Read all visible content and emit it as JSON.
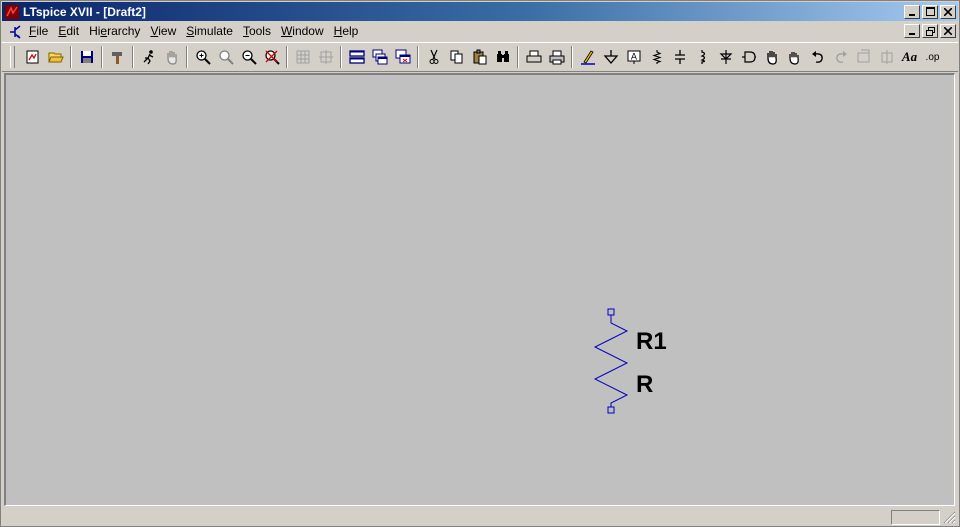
{
  "window": {
    "title": "LTspice XVII - [Draft2]"
  },
  "menu": {
    "items": [
      {
        "id": "file",
        "pre": "",
        "acc": "F",
        "post": "ile"
      },
      {
        "id": "edit",
        "pre": "",
        "acc": "E",
        "post": "dit"
      },
      {
        "id": "hierarchy",
        "pre": "Hi",
        "acc": "e",
        "post": "rarchy"
      },
      {
        "id": "view",
        "pre": "",
        "acc": "V",
        "post": "iew"
      },
      {
        "id": "simulate",
        "pre": "",
        "acc": "S",
        "post": "imulate"
      },
      {
        "id": "tools",
        "pre": "",
        "acc": "T",
        "post": "ools"
      },
      {
        "id": "window",
        "pre": "",
        "acc": "W",
        "post": "indow"
      },
      {
        "id": "help",
        "pre": "",
        "acc": "H",
        "post": "elp"
      }
    ]
  },
  "toolbar": {
    "text_button_label": "Aa",
    "spice_directive_label": ".op"
  },
  "schematic": {
    "wire_color": "#0000c0",
    "label_color": "#000000",
    "background_color": "#c0c0c0",
    "component": {
      "type": "resistor",
      "reference": "R1",
      "value": "R"
    }
  },
  "status": {
    "text": ""
  }
}
